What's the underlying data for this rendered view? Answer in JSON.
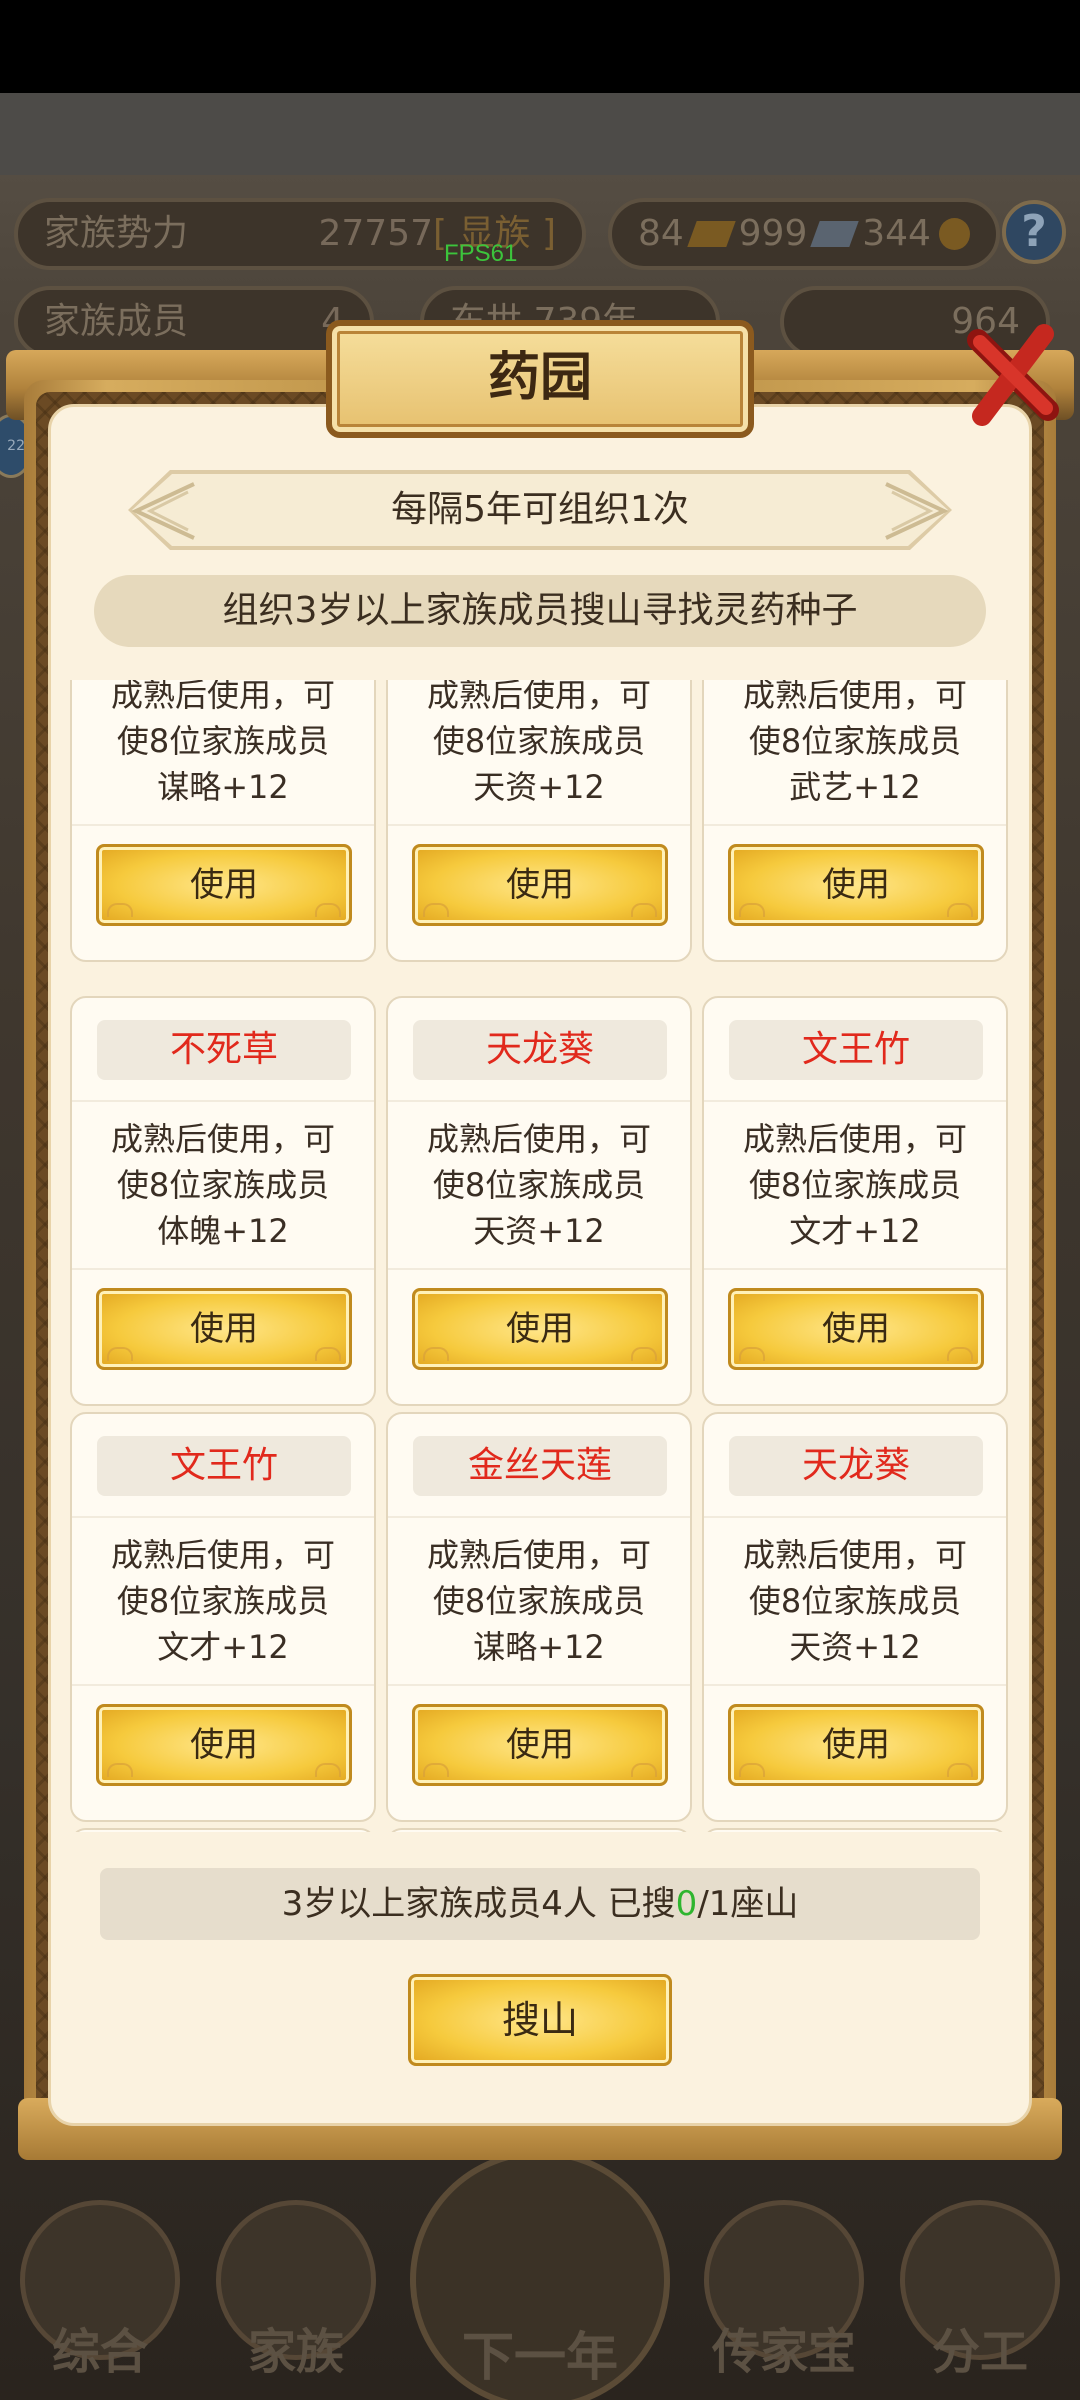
{
  "background": {
    "stats": {
      "clan_power_label": "家族势力",
      "clan_power_value": "27757",
      "clan_power_tag": "[ 显族 ]",
      "gold_value": "84",
      "silver_value": "999",
      "tickets_value": "344",
      "members_label": "家族成员",
      "members_value": "4",
      "year_text": "东世 739年",
      "ingot_value": "964"
    },
    "help_label": "?",
    "fps_text": "FPS61",
    "side_badge": "22",
    "nav": {
      "overview": "综合",
      "family": "家族",
      "next_year": "下一年",
      "heirloom": "传家宝",
      "assign": "分工"
    }
  },
  "dialog": {
    "title": "药园",
    "subtitle": "每隔5年可组织1次",
    "description": "组织3岁以上家族成员搜山寻找灵药种子",
    "use_label": "使用",
    "herbs": [
      {
        "name": "",
        "desc": [
          "成熟后使用，可",
          "使8位家族成员",
          "谋略+12"
        ]
      },
      {
        "name": "",
        "desc": [
          "成熟后使用，可",
          "使8位家族成员",
          "天资+12"
        ]
      },
      {
        "name": "",
        "desc": [
          "成熟后使用，可",
          "使8位家族成员",
          "武艺+12"
        ]
      },
      {
        "name": "不死草",
        "desc": [
          "成熟后使用，可",
          "使8位家族成员",
          "体魄+12"
        ]
      },
      {
        "name": "天龙葵",
        "desc": [
          "成熟后使用，可",
          "使8位家族成员",
          "天资+12"
        ]
      },
      {
        "name": "文王竹",
        "desc": [
          "成熟后使用，可",
          "使8位家族成员",
          "文才+12"
        ]
      },
      {
        "name": "文王竹",
        "desc": [
          "成熟后使用，可",
          "使8位家族成员",
          "文才+12"
        ]
      },
      {
        "name": "金丝天莲",
        "desc": [
          "成熟后使用，可",
          "使8位家族成员",
          "谋略+12"
        ]
      },
      {
        "name": "天龙葵",
        "desc": [
          "成熟后使用，可",
          "使8位家族成员",
          "天资+12"
        ]
      }
    ],
    "count_prefix": "3岁以上家族成员4人 已搜",
    "count_searched": "0",
    "count_suffix": "/1座山",
    "search_button": "搜山"
  },
  "colors": {
    "herb_name": "#e1291c",
    "searched_count": "#2fb52f",
    "button_gold": "#f6ca3d"
  }
}
